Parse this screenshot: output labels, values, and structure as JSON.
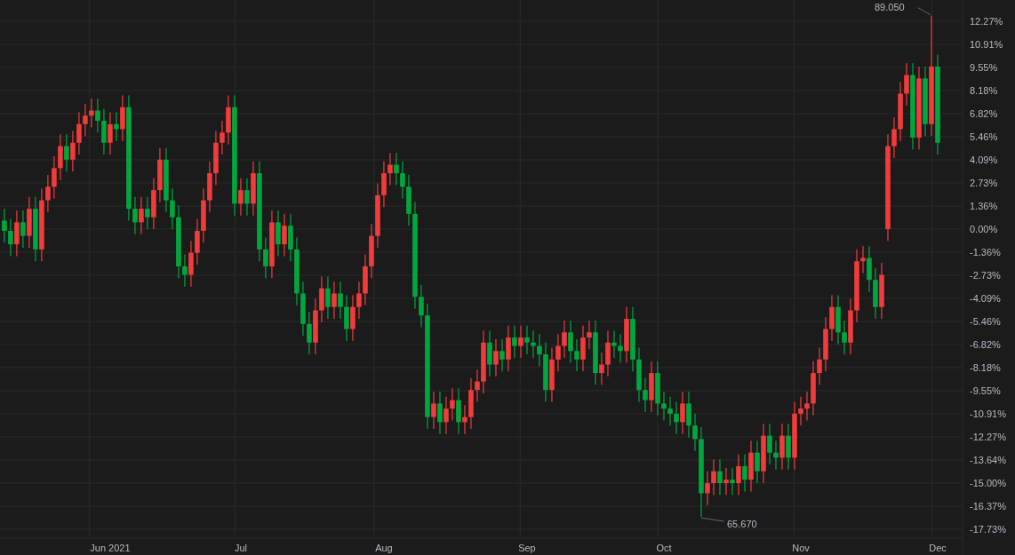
{
  "chart_data": {
    "type": "candlestick",
    "ylim": [
      -18.25,
      13.53
    ],
    "grid": true,
    "yticks": [
      {
        "value": 12.27,
        "label": "12.27%"
      },
      {
        "value": 10.91,
        "label": "10.91%"
      },
      {
        "value": 9.55,
        "label": "9.55%"
      },
      {
        "value": 8.18,
        "label": "8.18%"
      },
      {
        "value": 6.82,
        "label": "6.82%"
      },
      {
        "value": 5.46,
        "label": "5.46%"
      },
      {
        "value": 4.09,
        "label": "4.09%"
      },
      {
        "value": 2.73,
        "label": "2.73%"
      },
      {
        "value": 1.36,
        "label": "1.36%"
      },
      {
        "value": 0,
        "label": "0.00%"
      },
      {
        "value": -1.36,
        "label": "-1.36%"
      },
      {
        "value": -2.73,
        "label": "-2.73%"
      },
      {
        "value": -4.09,
        "label": "-4.09%"
      },
      {
        "value": -5.46,
        "label": "-5.46%"
      },
      {
        "value": -6.82,
        "label": "-6.82%"
      },
      {
        "value": -8.18,
        "label": "-8.18%"
      },
      {
        "value": -9.55,
        "label": "-9.55%"
      },
      {
        "value": -10.91,
        "label": "-10.91%"
      },
      {
        "value": -12.27,
        "label": "-12.27%"
      },
      {
        "value": -13.64,
        "label": "-13.64%"
      },
      {
        "value": -15.0,
        "label": "-15.00%"
      },
      {
        "value": -16.37,
        "label": "-16.37%"
      },
      {
        "value": -17.73,
        "label": "-17.73%"
      }
    ],
    "categories": [
      null,
      null,
      null,
      null,
      null,
      null,
      null,
      null,
      null,
      null,
      null,
      null,
      null,
      null,
      null,
      null,
      null,
      "Jun 2021",
      null,
      null,
      null,
      null,
      null,
      null,
      null,
      null,
      null,
      null,
      null,
      null,
      null,
      null,
      null,
      null,
      null,
      null,
      null,
      null,
      "Jul",
      null,
      null,
      null,
      null,
      null,
      null,
      null,
      null,
      null,
      null,
      null,
      null,
      null,
      null,
      null,
      null,
      null,
      null,
      null,
      null,
      null,
      null,
      "Aug",
      null,
      null,
      null,
      null,
      null,
      null,
      null,
      null,
      null,
      null,
      null,
      null,
      null,
      null,
      null,
      null,
      null,
      null,
      null,
      null,
      null,
      null,
      "Sep",
      null,
      null,
      null,
      null,
      null,
      null,
      null,
      null,
      null,
      null,
      null,
      null,
      null,
      null,
      null,
      null,
      null,
      null,
      null,
      null,
      null,
      "Oct",
      null,
      null,
      null,
      null,
      null,
      null,
      null,
      null,
      null,
      null,
      null,
      null,
      null,
      null,
      null,
      null,
      null,
      null,
      null,
      null,
      null,
      "Nov",
      null,
      null,
      null,
      null,
      null,
      null,
      null,
      null,
      null,
      null,
      null,
      null,
      null,
      null,
      null,
      null,
      null,
      null,
      null,
      null,
      null,
      "Dec"
    ],
    "ohlc": [
      [
        0.5,
        1.2,
        -0.8,
        -0.1
      ],
      [
        -0.1,
        0.6,
        -1.6,
        -0.9
      ],
      [
        -0.9,
        1.1,
        -1.6,
        0.4
      ],
      [
        0.4,
        1.1,
        -1.1,
        -0.4
      ],
      [
        -0.4,
        1.9,
        -1.1,
        1.2
      ],
      [
        1.2,
        1.9,
        -1.9,
        -1.2
      ],
      [
        -1.2,
        2.4,
        -1.9,
        1.7
      ],
      [
        1.7,
        3.2,
        1.0,
        2.5
      ],
      [
        2.5,
        4.3,
        1.8,
        3.6
      ],
      [
        3.6,
        5.6,
        2.9,
        4.9
      ],
      [
        4.9,
        5.6,
        3.4,
        4.1
      ],
      [
        4.1,
        5.8,
        3.4,
        5.1
      ],
      [
        5.1,
        6.9,
        4.4,
        6.2
      ],
      [
        6.2,
        7.4,
        5.5,
        6.7
      ],
      [
        6.7,
        7.7,
        6.0,
        7.0
      ],
      [
        7.0,
        7.7,
        5.7,
        6.4
      ],
      [
        6.4,
        7.1,
        4.4,
        5.1
      ],
      [
        5.1,
        6.9,
        4.4,
        6.2
      ],
      [
        6.2,
        6.9,
        5.2,
        5.9
      ],
      [
        5.9,
        7.9,
        5.2,
        7.2
      ],
      [
        7.2,
        7.9,
        0.5,
        1.2
      ],
      [
        1.2,
        1.9,
        -0.3,
        0.4
      ],
      [
        0.4,
        1.9,
        -0.3,
        1.2
      ],
      [
        1.2,
        1.9,
        0.0,
        0.7
      ],
      [
        0.7,
        3.0,
        0.0,
        2.3
      ],
      [
        2.3,
        4.8,
        1.6,
        4.1
      ],
      [
        4.1,
        4.8,
        1.0,
        1.7
      ],
      [
        1.7,
        2.4,
        0.0,
        0.7
      ],
      [
        0.7,
        1.4,
        -2.9,
        -2.2
      ],
      [
        -2.2,
        -1.5,
        -3.4,
        -2.7
      ],
      [
        -2.7,
        -0.7,
        -3.4,
        -1.4
      ],
      [
        -1.4,
        0.6,
        -2.1,
        -0.1
      ],
      [
        -0.1,
        2.4,
        -0.8,
        1.7
      ],
      [
        1.7,
        4.0,
        1.0,
        3.3
      ],
      [
        3.3,
        5.8,
        2.6,
        5.1
      ],
      [
        5.1,
        6.4,
        4.4,
        5.7
      ],
      [
        5.7,
        7.9,
        5.0,
        7.2
      ],
      [
        7.2,
        7.9,
        0.8,
        1.5
      ],
      [
        1.5,
        3.0,
        0.8,
        2.3
      ],
      [
        2.3,
        3.0,
        0.8,
        1.5
      ],
      [
        1.5,
        4.0,
        0.8,
        3.3
      ],
      [
        3.3,
        4.0,
        -1.9,
        -1.2
      ],
      [
        -1.2,
        -0.5,
        -2.9,
        -2.2
      ],
      [
        -2.2,
        1.1,
        -2.9,
        0.4
      ],
      [
        0.4,
        1.1,
        -1.6,
        -0.9
      ],
      [
        -0.9,
        0.9,
        -1.6,
        0.2
      ],
      [
        0.2,
        0.9,
        -1.9,
        -1.2
      ],
      [
        -1.2,
        -0.5,
        -4.5,
        -3.8
      ],
      [
        -3.8,
        -3.1,
        -6.3,
        -5.6
      ],
      [
        -5.6,
        -4.9,
        -7.4,
        -6.7
      ],
      [
        -6.7,
        -4.1,
        -7.4,
        -4.8
      ],
      [
        -4.8,
        -2.8,
        -5.5,
        -3.5
      ],
      [
        -3.5,
        -2.8,
        -5.3,
        -4.6
      ],
      [
        -4.6,
        -3.1,
        -5.3,
        -3.8
      ],
      [
        -3.8,
        -3.1,
        -5.3,
        -4.6
      ],
      [
        -4.6,
        -3.9,
        -6.6,
        -5.9
      ],
      [
        -5.9,
        -3.9,
        -6.6,
        -4.6
      ],
      [
        -4.6,
        -3.1,
        -5.3,
        -3.8
      ],
      [
        -3.8,
        -1.5,
        -4.5,
        -2.2
      ],
      [
        -2.2,
        0.3,
        -2.9,
        -0.4
      ],
      [
        -0.4,
        2.7,
        -1.1,
        2.0
      ],
      [
        2.0,
        4.0,
        1.3,
        3.3
      ],
      [
        3.3,
        4.5,
        2.6,
        3.8
      ],
      [
        3.8,
        4.5,
        2.6,
        3.3
      ],
      [
        3.3,
        4.0,
        1.8,
        2.5
      ],
      [
        2.5,
        3.2,
        0.2,
        0.9
      ],
      [
        0.9,
        1.6,
        -4.7,
        -4.0
      ],
      [
        -4.0,
        -3.3,
        -5.8,
        -5.1
      ],
      [
        -5.1,
        -4.4,
        -11.8,
        -11.1
      ],
      [
        -11.1,
        -9.6,
        -11.8,
        -10.3
      ],
      [
        -10.3,
        -9.6,
        -12.1,
        -11.4
      ],
      [
        -11.4,
        -9.9,
        -12.1,
        -10.6
      ],
      [
        -10.6,
        -9.4,
        -11.3,
        -10.1
      ],
      [
        -10.1,
        -9.4,
        -12.1,
        -11.4
      ],
      [
        -11.4,
        -10.4,
        -12.1,
        -11.1
      ],
      [
        -11.1,
        -8.8,
        -11.8,
        -9.5
      ],
      [
        -9.5,
        -8.3,
        -10.2,
        -9.0
      ],
      [
        -9.0,
        -6.0,
        -9.7,
        -6.7
      ],
      [
        -6.7,
        -6.0,
        -8.7,
        -8.0
      ],
      [
        -8.0,
        -6.5,
        -8.7,
        -7.2
      ],
      [
        -7.2,
        -6.5,
        -8.4,
        -7.7
      ],
      [
        -7.7,
        -5.7,
        -8.4,
        -6.4
      ],
      [
        -6.4,
        -5.7,
        -7.6,
        -6.9
      ],
      [
        -6.9,
        -5.7,
        -7.6,
        -6.4
      ],
      [
        -6.4,
        -5.7,
        -7.4,
        -6.7
      ],
      [
        -6.7,
        -6.0,
        -7.6,
        -6.9
      ],
      [
        -6.9,
        -6.2,
        -8.1,
        -7.4
      ],
      [
        -7.4,
        -6.7,
        -10.2,
        -9.5
      ],
      [
        -9.5,
        -7.0,
        -10.2,
        -7.7
      ],
      [
        -7.7,
        -6.2,
        -8.4,
        -6.9
      ],
      [
        -6.9,
        -5.4,
        -7.6,
        -6.1
      ],
      [
        -6.1,
        -5.4,
        -7.9,
        -7.2
      ],
      [
        -7.2,
        -6.5,
        -8.4,
        -7.7
      ],
      [
        -7.7,
        -5.7,
        -8.4,
        -6.4
      ],
      [
        -6.4,
        -5.4,
        -7.1,
        -6.1
      ],
      [
        -6.1,
        -5.4,
        -9.2,
        -8.5
      ],
      [
        -8.5,
        -7.3,
        -9.2,
        -8.0
      ],
      [
        -8.0,
        -6.0,
        -8.7,
        -6.7
      ],
      [
        -6.7,
        -6.0,
        -7.6,
        -6.9
      ],
      [
        -6.9,
        -6.2,
        -7.9,
        -7.2
      ],
      [
        -7.2,
        -4.6,
        -7.9,
        -5.3
      ],
      [
        -5.3,
        -4.6,
        -8.4,
        -7.7
      ],
      [
        -7.7,
        -7.0,
        -10.2,
        -9.5
      ],
      [
        -9.5,
        -8.8,
        -10.8,
        -10.1
      ],
      [
        -10.1,
        -7.8,
        -10.8,
        -8.5
      ],
      [
        -8.5,
        -7.8,
        -11.0,
        -10.3
      ],
      [
        -10.3,
        -9.6,
        -11.3,
        -10.6
      ],
      [
        -10.6,
        -9.9,
        -11.6,
        -10.9
      ],
      [
        -10.9,
        -10.2,
        -12.1,
        -11.4
      ],
      [
        -11.4,
        -9.6,
        -12.1,
        -10.3
      ],
      [
        -10.3,
        -9.6,
        -12.3,
        -11.6
      ],
      [
        -11.6,
        -10.9,
        -13.1,
        -12.4
      ],
      [
        -12.4,
        -11.7,
        -17.0,
        -15.6
      ],
      [
        -15.6,
        -14.3,
        -16.3,
        -15.0
      ],
      [
        -15.0,
        -13.6,
        -15.7,
        -14.3
      ],
      [
        -14.3,
        -13.6,
        -15.7,
        -15.0
      ],
      [
        -15.0,
        -14.1,
        -15.7,
        -14.8
      ],
      [
        -14.8,
        -14.1,
        -15.7,
        -15.0
      ],
      [
        -15.0,
        -13.3,
        -15.7,
        -14.0
      ],
      [
        -14.0,
        -13.3,
        -15.5,
        -14.8
      ],
      [
        -14.8,
        -12.5,
        -15.5,
        -13.2
      ],
      [
        -13.2,
        -12.5,
        -15.0,
        -14.3
      ],
      [
        -14.3,
        -11.5,
        -15.0,
        -12.2
      ],
      [
        -12.2,
        -11.5,
        -13.9,
        -13.2
      ],
      [
        -13.2,
        -12.5,
        -14.2,
        -13.5
      ],
      [
        -13.5,
        -11.5,
        -14.2,
        -12.2
      ],
      [
        -12.2,
        -11.5,
        -14.2,
        -13.5
      ],
      [
        -13.5,
        -10.2,
        -14.2,
        -10.9
      ],
      [
        -10.9,
        -9.9,
        -11.6,
        -10.6
      ],
      [
        -10.6,
        -9.6,
        -11.3,
        -10.3
      ],
      [
        -10.3,
        -7.8,
        -11.0,
        -8.5
      ],
      [
        -8.5,
        -7.0,
        -9.2,
        -7.7
      ],
      [
        -7.7,
        -5.2,
        -8.4,
        -5.9
      ],
      [
        -5.9,
        -3.9,
        -6.6,
        -4.6
      ],
      [
        -4.6,
        -3.9,
        -6.8,
        -6.1
      ],
      [
        -6.1,
        -5.4,
        -7.4,
        -6.7
      ],
      [
        -6.7,
        -4.1,
        -7.4,
        -4.8
      ],
      [
        -4.8,
        -1.2,
        -5.5,
        -1.9
      ],
      [
        -1.9,
        -1.0,
        -2.6,
        -1.7
      ],
      [
        -1.7,
        -1.0,
        -3.7,
        -3.0
      ],
      [
        -3.0,
        -2.3,
        -5.3,
        -4.6
      ],
      [
        -4.6,
        -2.0,
        -5.3,
        -2.7
      ],
      [
        0.0,
        5.6,
        -0.7,
        4.9
      ],
      [
        4.9,
        6.6,
        4.2,
        5.9
      ],
      [
        5.9,
        8.7,
        5.2,
        8.0
      ],
      [
        8.0,
        9.8,
        7.3,
        9.1
      ],
      [
        9.1,
        9.8,
        4.7,
        5.4
      ],
      [
        5.4,
        9.6,
        4.7,
        8.9
      ],
      [
        8.9,
        9.6,
        5.5,
        6.2
      ],
      [
        6.2,
        12.6,
        5.5,
        9.6
      ],
      [
        9.6,
        10.3,
        4.4,
        5.1
      ]
    ],
    "annotations": [
      "89.050",
      "65.670"
    ]
  }
}
